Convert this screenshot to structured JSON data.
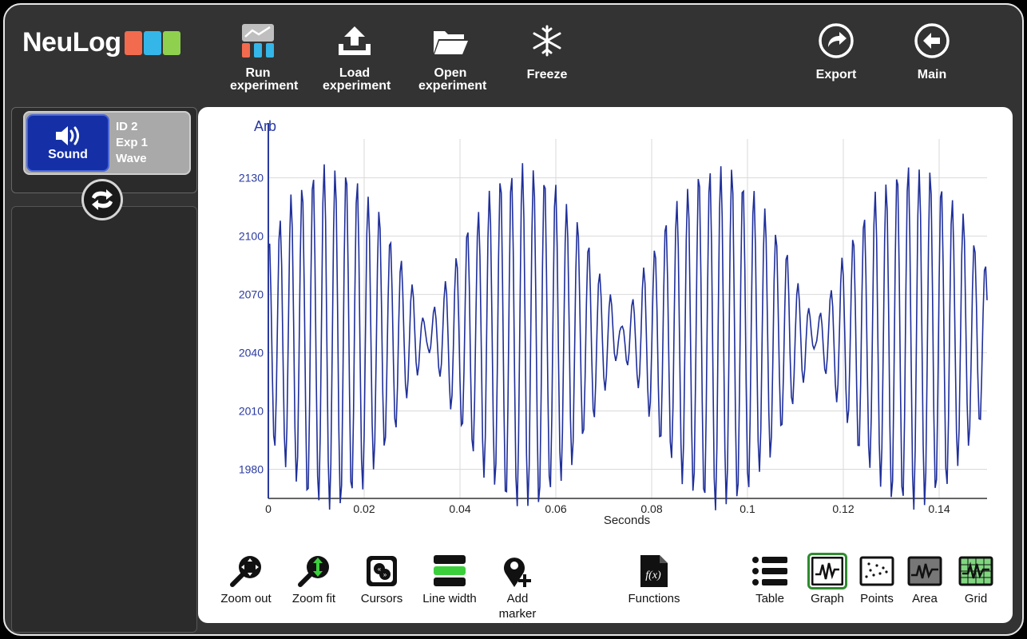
{
  "app": {
    "logo_text": "NeuLog",
    "logo_colors": [
      "#f26b4f",
      "#35b6e8",
      "#8fd14f"
    ]
  },
  "toolbar": {
    "run": "Run experiment",
    "load": "Load experiment",
    "open": "Open experiment",
    "freeze": "Freeze",
    "export": "Export",
    "main": "Main"
  },
  "sensor": {
    "name": "Sound",
    "id": "ID 2",
    "exp": "Exp 1",
    "mode": "Wave",
    "color": "#1530a6"
  },
  "bottom_toolbar": {
    "zoom_out": "Zoom out",
    "zoom_fit": "Zoom fit",
    "cursors": "Cursors",
    "line_width": "Line width",
    "add_marker_1": "Add",
    "add_marker_2": "marker",
    "functions": "Functions",
    "table": "Table",
    "graph": "Graph",
    "points": "Points",
    "area": "Area",
    "grid": "Grid",
    "selected_view": "Graph"
  },
  "chart_data": {
    "type": "line",
    "ylabel": "Arb",
    "xlabel": "Seconds",
    "xlim": [
      0,
      0.15
    ],
    "ylim": [
      1965,
      2150
    ],
    "x_ticks": [
      "0",
      "0.02",
      "0.04",
      "0.06",
      "0.08",
      "0.1",
      "0.12",
      "0.14"
    ],
    "y_ticks": [
      "1980",
      "2010",
      "2040",
      "2070",
      "2100",
      "2130"
    ],
    "grid": true,
    "series": [
      {
        "color": "#1f2f9a",
        "signal": "beat waveform",
        "center": 2048,
        "amplitude_max": 92,
        "carrier_period_s": 0.0023,
        "beat_period_s": 0.0405,
        "beat_phase_s": 0.013,
        "x_start": 0,
        "x_end": 0.15,
        "n_points": 540
      }
    ]
  }
}
